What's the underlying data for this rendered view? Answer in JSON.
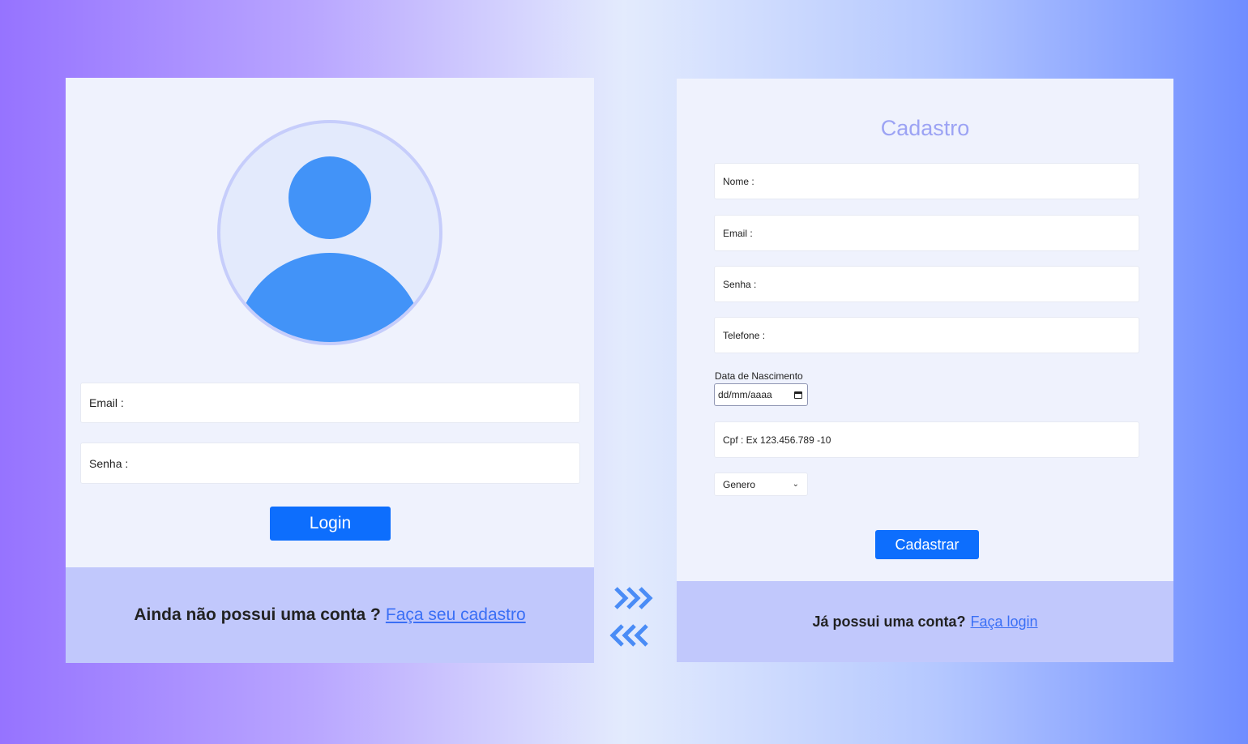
{
  "login": {
    "email_placeholder": "Email :",
    "password_placeholder": "Senha :",
    "button_label": "Login",
    "footer_text": "Ainda não possui uma conta ?",
    "footer_link": "Faça seu cadastro"
  },
  "register": {
    "title": "Cadastro",
    "name_placeholder": "Nome :",
    "email_placeholder": "Email :",
    "password_placeholder": "Senha :",
    "phone_placeholder": "Telefone :",
    "birth_label": "Data de Nascimento",
    "birth_placeholder": "dd/mm/aaaa",
    "cpf_placeholder": "Cpf : Ex 123.456.789 -10",
    "gender_selected": "Genero",
    "button_label": "Cadastrar",
    "footer_text": "Já possui uma conta?",
    "footer_link": "Faça login"
  },
  "icons": {
    "avatar": "user-avatar-icon",
    "calendar": "calendar-icon",
    "dropdown": "chevron-down-icon",
    "arrows": "switch-arrows-icon"
  },
  "colors": {
    "accent": "#0d6efd",
    "avatar": "#4293f8",
    "panel": "#eff2fd",
    "footer": "#c1c8fc",
    "title": "#9ca3f4",
    "link": "#3a6ff5"
  }
}
